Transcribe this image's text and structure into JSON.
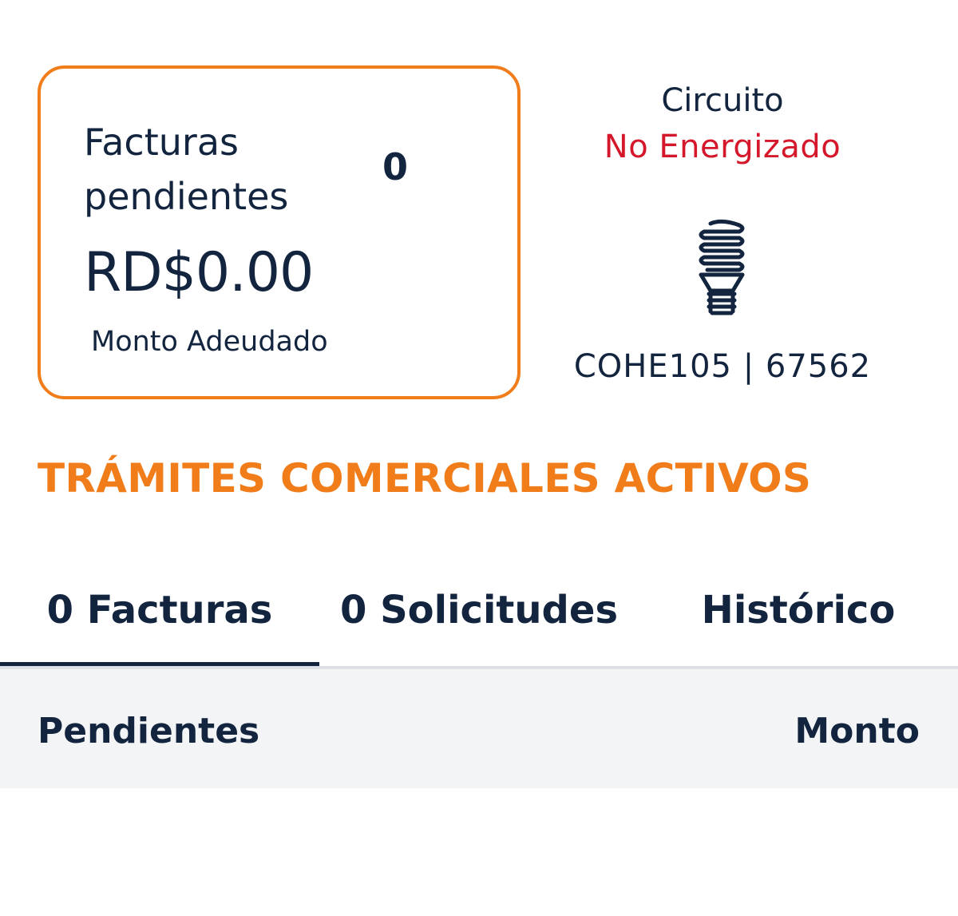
{
  "summary_card": {
    "title": "Facturas pendientes",
    "count": "0",
    "amount": "RD$0.00",
    "amount_label": "Monto Adeudado"
  },
  "circuit": {
    "label": "Circuito",
    "status": "No Energizado",
    "status_color": "#d5172b",
    "icon": "light-bulb-icon",
    "code": "COHE105 | 67562"
  },
  "section": {
    "title": "TRÁMITES COMERCIALES ACTIVOS",
    "accent_color": "#f07d1a"
  },
  "tabs": [
    {
      "label": "0 Facturas",
      "active": true
    },
    {
      "label": "0 Solicitudes",
      "active": false
    },
    {
      "label": "Histórico",
      "active": false
    }
  ],
  "table": {
    "col_left": "Pendientes",
    "col_right": "Monto"
  }
}
